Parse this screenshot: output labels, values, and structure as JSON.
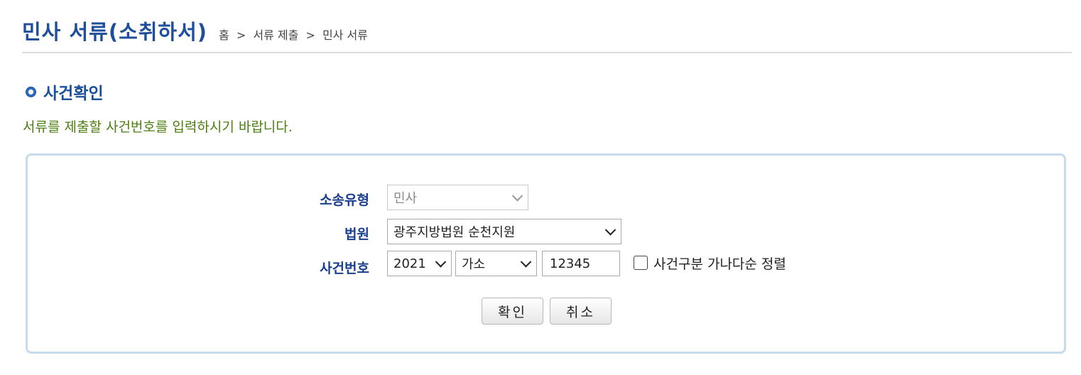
{
  "header": {
    "title": "민사 서류(소취하서)",
    "breadcrumb": [
      "홈",
      "서류 제출",
      "민사 서류"
    ],
    "breadcrumb_separator": ">"
  },
  "section": {
    "title": "사건확인",
    "instruction": "서류를 제출할 사건번호를 입력하시기 바랍니다."
  },
  "form": {
    "litigation_type": {
      "label": "소송유형",
      "value": "민사",
      "disabled": true
    },
    "court": {
      "label": "법원",
      "value": "광주지방법원 순천지원"
    },
    "case_number": {
      "label": "사건번호",
      "year": "2021",
      "case_type": "가소",
      "serial": "12345"
    },
    "sort_checkbox": {
      "label": "사건구분 가나다순 정렬",
      "checked": false
    },
    "confirm_label": "확인",
    "cancel_label": "취소"
  },
  "colors": {
    "title": "#1f4e9c",
    "instruction": "#4c7d10",
    "label": "#1a3f8f",
    "panel_border": "#c5dcef"
  }
}
